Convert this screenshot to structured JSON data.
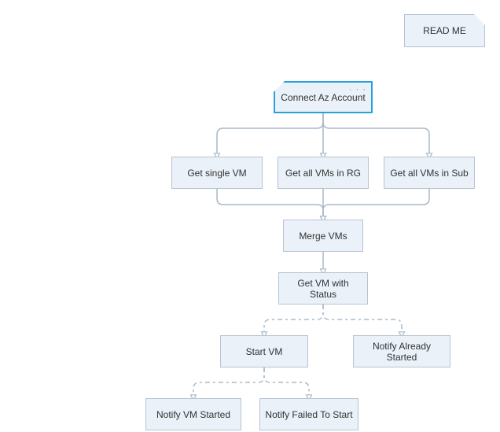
{
  "workflow": {
    "readme": {
      "label": "READ ME"
    },
    "connect": {
      "label": "Connect Az Account"
    },
    "get_single_vm": {
      "label": "Get single VM"
    },
    "get_all_vms_rg": {
      "label": "Get all VMs in RG"
    },
    "get_all_vms_sub": {
      "label": "Get all VMs in Sub"
    },
    "merge_vms": {
      "label": "Merge VMs"
    },
    "get_vm_status": {
      "label": "Get VM with Status"
    },
    "start_vm": {
      "label": "Start VM"
    },
    "notify_already_started": {
      "label": "Notify Already Started"
    },
    "notify_vm_started": {
      "label": "Notify VM Started"
    },
    "notify_failed": {
      "label": "Notify Failed To Start"
    }
  },
  "colors": {
    "node_fill": "#eaf1f9",
    "node_border": "#b7c4cf",
    "selected_border": "#2aa0db",
    "connector": "#a9b9c7"
  }
}
